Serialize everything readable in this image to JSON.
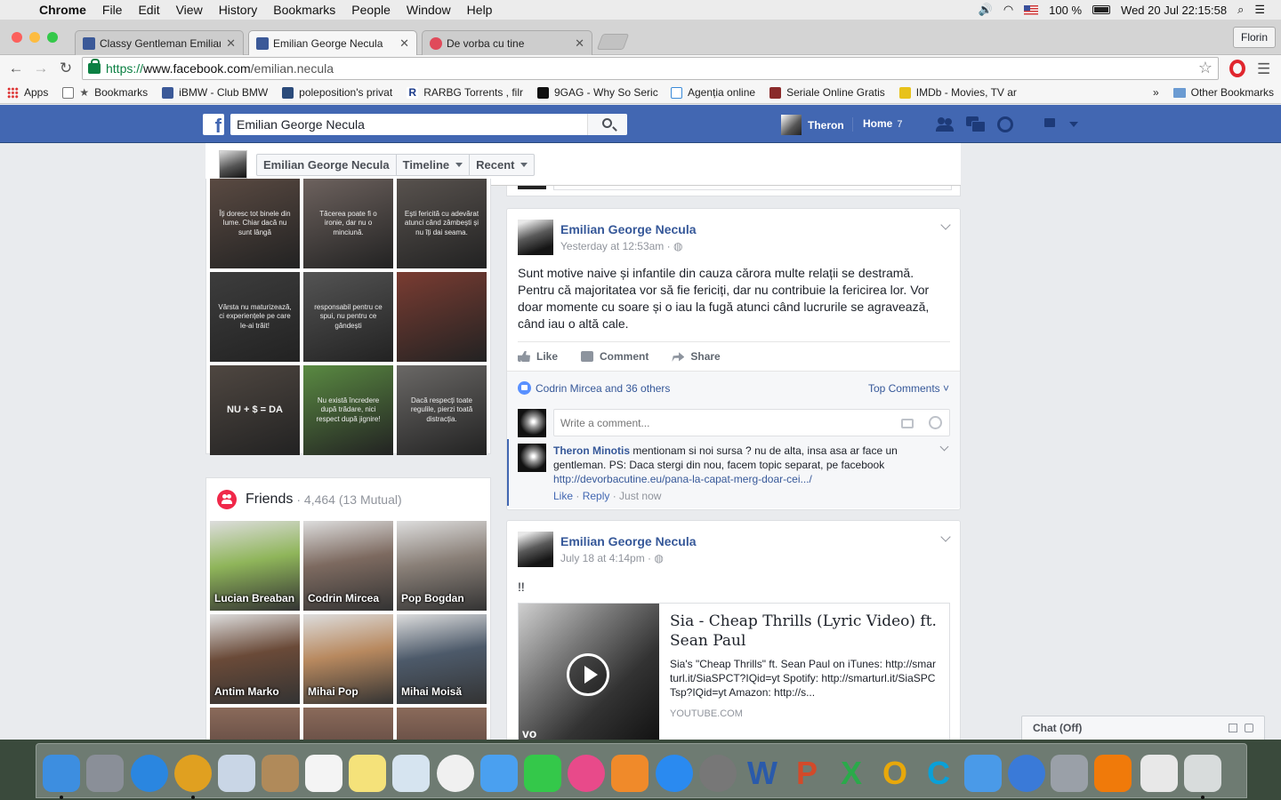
{
  "menubar": {
    "app": "Chrome",
    "items": [
      "File",
      "Edit",
      "View",
      "History",
      "Bookmarks",
      "People",
      "Window",
      "Help"
    ],
    "battery": "100 %",
    "clock": "Wed 20 Jul  22:15:58"
  },
  "tabs": [
    {
      "label": "Classy Gentleman Emilianu",
      "color": "#3b5998"
    },
    {
      "label": "Emilian George Necula",
      "color": "#3b5998"
    },
    {
      "label": "De vorba cu tine",
      "color": "#e04a5a"
    }
  ],
  "profile": "Florin",
  "address": {
    "scheme": "https://",
    "host": "www.facebook.com",
    "path": "/emilian.necula"
  },
  "bookmarks": {
    "items": [
      {
        "label": "Apps"
      },
      {
        "label": "Bookmarks"
      },
      {
        "label": "iBMW - Club BMW"
      },
      {
        "label": "poleposition's privat"
      },
      {
        "label": "RARBG Torrents , filr"
      },
      {
        "label": "9GAG - Why So Seric"
      },
      {
        "label": "Agenția online"
      },
      {
        "label": "Seriale Online Gratis"
      },
      {
        "label": "IMDb - Movies, TV ar"
      }
    ],
    "overflow": "»",
    "other": "Other Bookmarks"
  },
  "fb": {
    "search_value": "Emilian George Necula",
    "user": "Theron",
    "home": "Home",
    "home_count": "7"
  },
  "sticky": {
    "name": "Emilian George Necula",
    "timeline": "Timeline",
    "recent": "Recent"
  },
  "photos": [
    {
      "text": "Îți doresc tot binele din lume. Chiar dacă nu sunt lângă",
      "color": "#5a4a42"
    },
    {
      "text": "Tăcerea poate fi o ironie, dar nu o minciună.",
      "color": "#6d625e"
    },
    {
      "text": "Ești fericită cu adevărat atunci când zâmbești și nu îți dai seama.",
      "color": "#58524e"
    },
    {
      "text": "Vârsta nu maturizează, ci experiențele pe care le-ai trăit!",
      "color": "#3d3d3d"
    },
    {
      "text": "responsabil pentru ce spui, nu pentru ce gândești",
      "color": "#545454"
    },
    {
      "text": "",
      "color": "#7a3c32"
    },
    {
      "text": "NU + $ = DA",
      "color": "#4f4741"
    },
    {
      "text": "Nu există încredere după trădare, nici respect după jignire!",
      "color": "#5a8a42"
    },
    {
      "text": "Dacă respecți toate regulile, pierzi toată distracția.",
      "color": "#6a6866"
    }
  ],
  "friends": {
    "title": "Friends",
    "count": "· 4,464 (13 Mutual)",
    "items": [
      {
        "name": "Lucian Breaban",
        "color": "#8fb55a"
      },
      {
        "name": "Codrin Mircea",
        "color": "#7d6a60"
      },
      {
        "name": "Pop Bogdan",
        "color": "#8a8078"
      },
      {
        "name": "Antim Marko",
        "color": "#6a4a38"
      },
      {
        "name": "Mihai Pop",
        "color": "#b8895f"
      },
      {
        "name": "Mihai Moisă",
        "color": "#4d5a6a"
      }
    ]
  },
  "post1": {
    "author": "Emilian George Necula",
    "time": "Yesterday at 12:53am · ",
    "text": "Sunt motive naive și infantile din cauza cărora multe relații se destramă. Pentru că majoritatea vor să fie fericiți, dar nu contribuie la fericirea lor. Vor doar momente cu soare și o iau la fugă atunci când lucrurile se agravează, când iau o altă cale.",
    "like": "Like",
    "comment": "Comment",
    "share": "Share",
    "likes": "Codrin Mircea and 36 others",
    "top_comments": "Top Comments ˅",
    "comment_placeholder": "Write a comment...",
    "reply": {
      "author": "Theron Minotis",
      "text": " mentionam si noi sursa ? nu de alta, insa asa ar face un gentleman. PS: Daca stergi din nou, facem topic separat, pe facebook",
      "link": "http://devorbacutine.eu/pana-la-capat-merg-doar-cei.../",
      "like": "Like",
      "reply": "Reply",
      "time": "Just now"
    }
  },
  "post2": {
    "author": "Emilian George Necula",
    "time": "July 18 at 4:14pm · ",
    "text": "!!",
    "card_title": "Sia - Cheap Thrills (Lyric Video) ft. Sean Paul",
    "card_desc": "Sia's \"Cheap Thrills\" ft. Sean Paul on iTunes: http://smarturl.it/SiaSPCT?IQid=yt Spotify: http://smarturl.it/SiaSPCTsp?IQid=yt Amazon: http://s...",
    "card_domain": "YOUTUBE.COM",
    "video_logo": "vo"
  },
  "chat": "Chat (Off)",
  "dock": [
    {
      "name": "finder",
      "color": "#3d8ee0"
    },
    {
      "name": "launchpad",
      "color": "#8a8f98"
    },
    {
      "name": "safari",
      "color": "#2a86e0"
    },
    {
      "name": "chrome",
      "color": "#e0a020"
    },
    {
      "name": "mail",
      "color": "#c9d6e6"
    },
    {
      "name": "contacts",
      "color": "#b08a5a"
    },
    {
      "name": "calendar",
      "color": "#f4f4f4"
    },
    {
      "name": "notes",
      "color": "#f5e27a"
    },
    {
      "name": "preview",
      "color": "#d6e4f0"
    },
    {
      "name": "photos",
      "color": "#f0f0f0"
    },
    {
      "name": "messages",
      "color": "#4aa0f0"
    },
    {
      "name": "facetime",
      "color": "#34c84a"
    },
    {
      "name": "itunes",
      "color": "#e84a8a"
    },
    {
      "name": "ibooks",
      "color": "#f08a2a"
    },
    {
      "name": "app-store",
      "color": "#2a8af0"
    },
    {
      "name": "system-preferences",
      "color": "#777777"
    },
    {
      "name": "word",
      "color": "#2a5aaa",
      "letter": "W"
    },
    {
      "name": "powerpoint",
      "color": "#d24a2a",
      "letter": "P"
    },
    {
      "name": "excel",
      "color": "#2aaa4a",
      "letter": "X"
    },
    {
      "name": "outlook",
      "color": "#e8a80a",
      "letter": "O"
    },
    {
      "name": "skype",
      "color": "#0aa0d8",
      "letter": "C"
    },
    {
      "name": "messenger-people",
      "color": "#4a9ae8"
    },
    {
      "name": "network",
      "color": "#3a7ad8"
    },
    {
      "name": "satellite",
      "color": "#9aa0a8"
    },
    {
      "name": "vlc",
      "color": "#f07a0a"
    },
    {
      "name": "utorrent",
      "color": "#e8e8e8"
    },
    {
      "name": "trash",
      "color": "#d8dcdc"
    }
  ]
}
